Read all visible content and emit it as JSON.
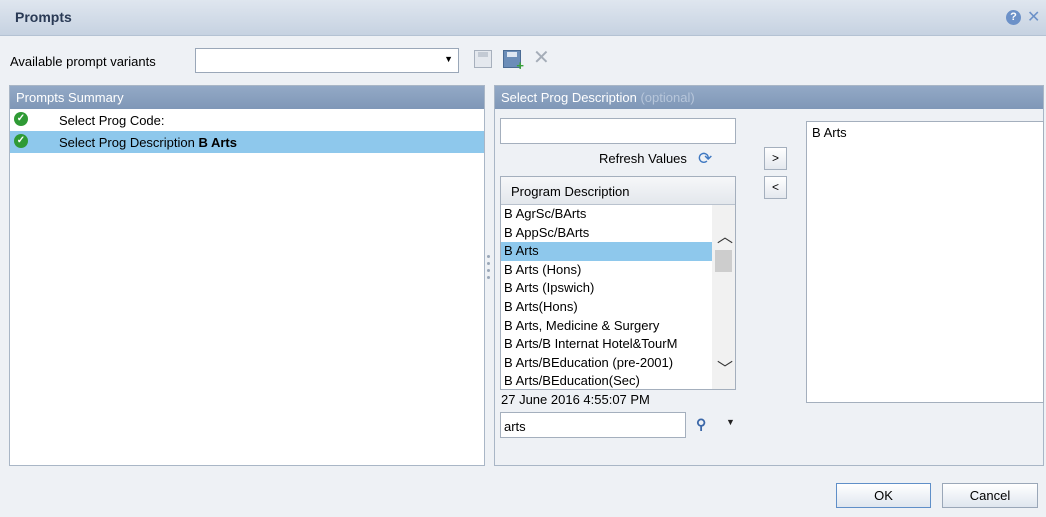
{
  "window": {
    "title": "Prompts",
    "help_glyph": "?",
    "close_glyph": "✕"
  },
  "variants": {
    "label": "Available prompt variants",
    "selected_value": ""
  },
  "summary": {
    "header": "Prompts Summary",
    "rows": [
      {
        "label": "Select Prog Code:",
        "value": ""
      },
      {
        "label": "Select Prog Description",
        "value": "B Arts"
      }
    ]
  },
  "prompt_panel": {
    "header": "Select Prog Description",
    "optional": "(optional)",
    "search_value": "",
    "refresh_label": "Refresh Values",
    "list_header": "Program Description",
    "items": [
      "B AgrSc/BArts",
      "B AppSc/BArts",
      "B Arts",
      "B Arts (Hons)",
      "B Arts (Ipswich)",
      "B Arts(Hons)",
      "B Arts, Medicine & Surgery",
      "B Arts/B Internat Hotel&TourM",
      "B Arts/BEducation (pre-2001)",
      "B Arts/BEducation(Sec)"
    ],
    "selected_item": "B Arts",
    "timestamp": "27 June 2016 4:55:07 PM",
    "filter_value": "arts",
    "move_right_label": ">",
    "move_left_label": "<",
    "selected_values": [
      "B Arts"
    ]
  },
  "buttons": {
    "ok": "OK",
    "cancel": "Cancel"
  },
  "colors": {
    "selection": "#8ec8ec",
    "header": "#8aa1c0",
    "check": "#2f9a35"
  }
}
